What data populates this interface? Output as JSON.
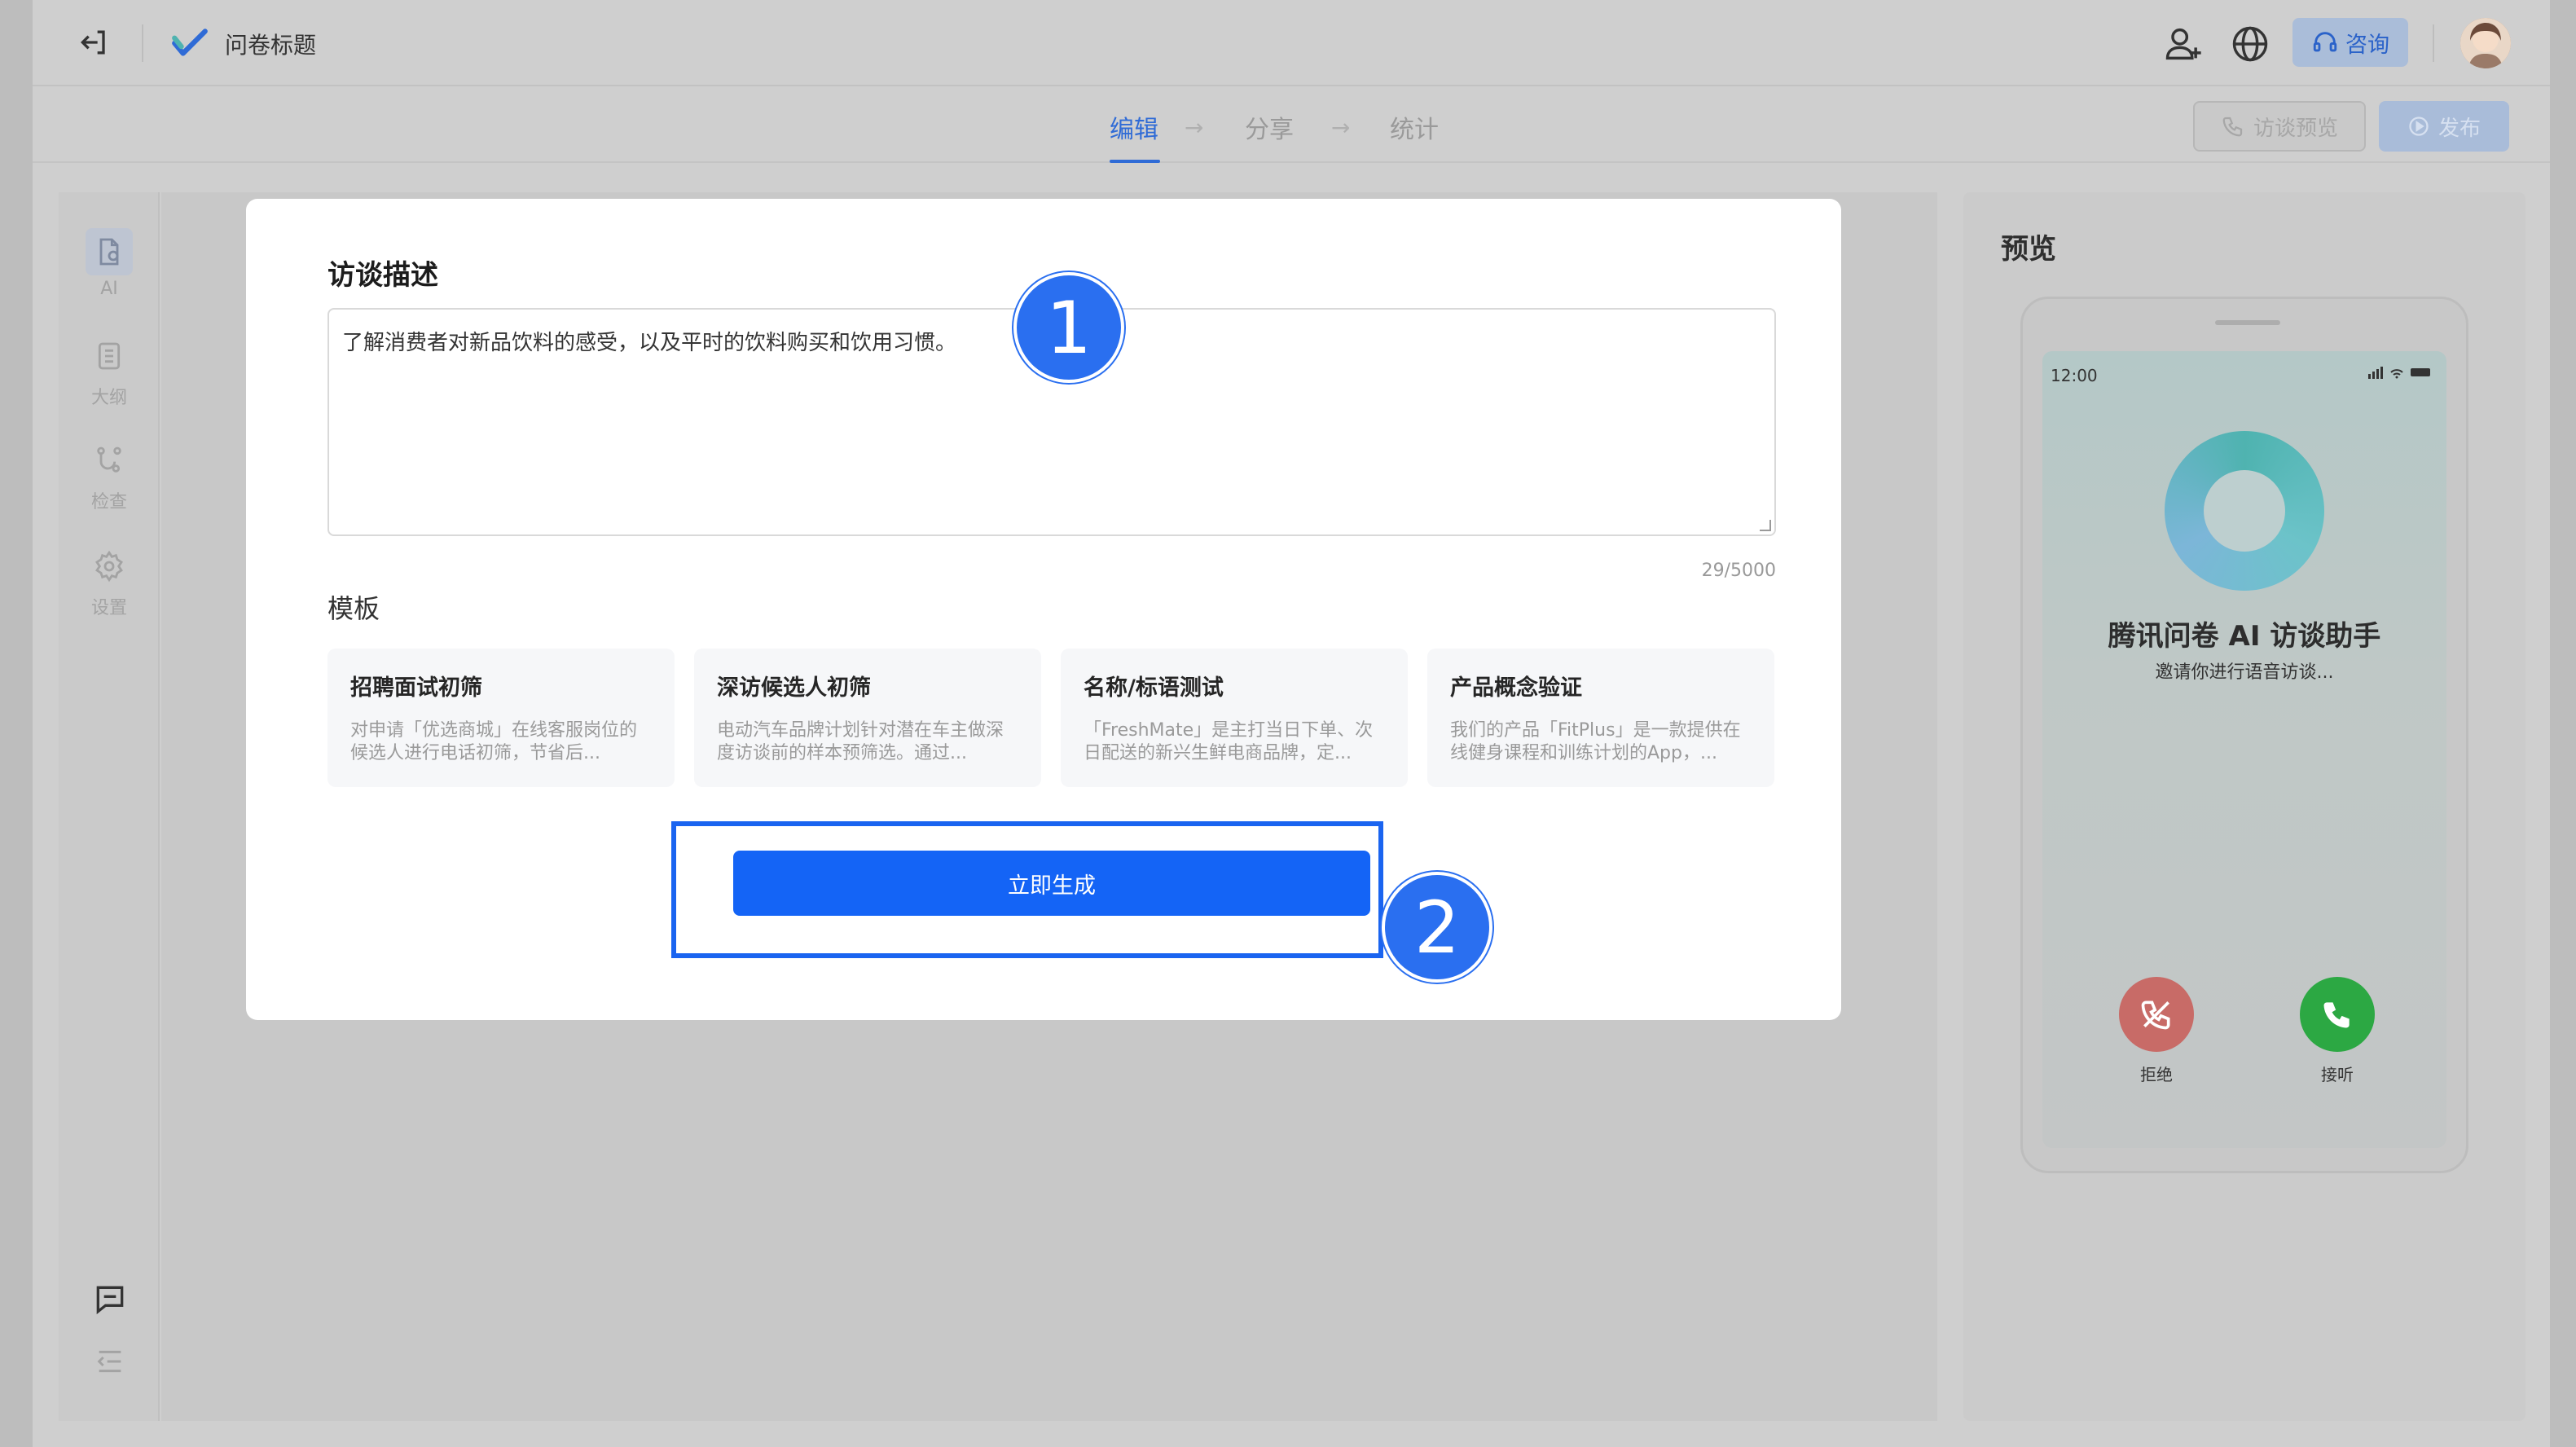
{
  "header": {
    "title": "问卷标题",
    "consult_label": "咨询"
  },
  "steps": {
    "edit": "编辑",
    "share": "分享",
    "stats": "统计",
    "arrow": "→"
  },
  "actions": {
    "preview_label": "访谈预览",
    "publish_label": "发布"
  },
  "sidebar": {
    "items": [
      {
        "label": "AI",
        "icon": "doc-ai-icon",
        "active": true
      },
      {
        "label": "大纲",
        "icon": "list-icon",
        "active": false
      },
      {
        "label": "检查",
        "icon": "check-flow-icon",
        "active": false
      },
      {
        "label": "设置",
        "icon": "gear-icon",
        "active": false
      }
    ]
  },
  "modal": {
    "title": "访谈描述",
    "description": "了解消费者对新品饮料的感受，以及平时的饮料购买和饮用习惯。",
    "counter": "29/5000",
    "template_label": "模板",
    "templates": [
      {
        "title": "招聘面试初筛",
        "desc": "对申请「优选商城」在线客服岗位的候选人进行电话初筛，节省后..."
      },
      {
        "title": "深访候选人初筛",
        "desc": "电动汽车品牌计划针对潜在车主做深度访谈前的样本预筛选。通过..."
      },
      {
        "title": "名称/标语测试",
        "desc": "「FreshMate」是主打当日下单、次日配送的新兴生鲜电商品牌，定..."
      },
      {
        "title": "产品概念验证",
        "desc": "我们的产品「FitPlus」是一款提供在线健身课程和训练计划的App，..."
      }
    ],
    "generate_label": "立即生成"
  },
  "callouts": {
    "one": "1",
    "two": "2"
  },
  "preview": {
    "title": "预览",
    "time": "12:00",
    "assistant_name": "腾讯问卷 AI 访谈助手",
    "assistant_sub": "邀请你进行语音访谈...",
    "decline_label": "拒绝",
    "answer_label": "接听"
  },
  "colors": {
    "primary": "#1464f6",
    "callout": "#2a6ff0",
    "decline": "#c86b67",
    "answer": "#2ca843"
  }
}
